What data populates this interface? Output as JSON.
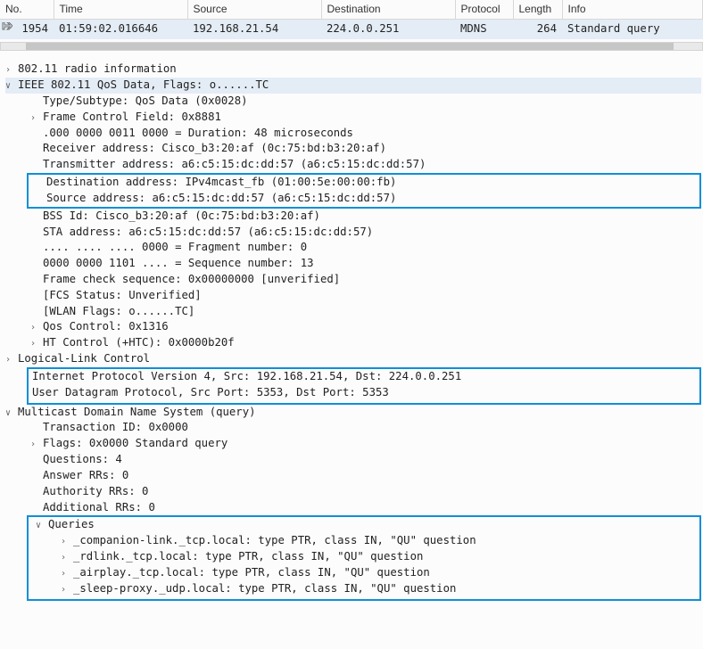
{
  "headers": {
    "no": "No.",
    "time": "Time",
    "src": "Source",
    "dst": "Destination",
    "proto": "Protocol",
    "len": "Length",
    "info": "Info"
  },
  "row": {
    "no": "1954",
    "time": "01:59:02.016646",
    "src": "192.168.21.54",
    "dst": "224.0.0.251",
    "proto": "MDNS",
    "len": "264",
    "info": "Standard query"
  },
  "tree": {
    "radio": "802.11 radio information",
    "ieee": "IEEE 802.11 QoS Data, Flags: o......TC",
    "ieee_children": {
      "type": "Type/Subtype: QoS Data (0x0028)",
      "fcf": "Frame Control Field: 0x8881",
      "duration": ".000 0000 0011 0000 = Duration: 48 microseconds",
      "recv": "Receiver address: Cisco_b3:20:af (0c:75:bd:b3:20:af)",
      "trans": "Transmitter address: a6:c5:15:dc:dd:57 (a6:c5:15:dc:dd:57)",
      "destaddr": "Destination address: IPv4mcast_fb (01:00:5e:00:00:fb)",
      "srcaddr": "Source address: a6:c5:15:dc:dd:57 (a6:c5:15:dc:dd:57)",
      "bss": "BSS Id: Cisco_b3:20:af (0c:75:bd:b3:20:af)",
      "sta": "STA address: a6:c5:15:dc:dd:57 (a6:c5:15:dc:dd:57)",
      "frag": ".... .... .... 0000 = Fragment number: 0",
      "seq": "0000 0000 1101 .... = Sequence number: 13",
      "fcs": "Frame check sequence: 0x00000000 [unverified]",
      "fcsstat": "[FCS Status: Unverified]",
      "wlanflags": "[WLAN Flags: o......TC]",
      "qos": "Qos Control: 0x1316",
      "ht": "HT Control (+HTC): 0x0000b20f"
    },
    "llc": "Logical-Link Control",
    "ipv4": "Internet Protocol Version 4, Src: 192.168.21.54, Dst: 224.0.0.251",
    "udp": "User Datagram Protocol, Src Port: 5353, Dst Port: 5353",
    "mdns": "Multicast Domain Name System (query)",
    "mdns_children": {
      "txid": "Transaction ID: 0x0000",
      "flags": "Flags: 0x0000 Standard query",
      "questions": "Questions: 4",
      "ans": "Answer RRs: 0",
      "auth": "Authority RRs: 0",
      "add": "Additional RRs: 0",
      "queries_label": "Queries",
      "queries": {
        "q1": "_companion-link._tcp.local: type PTR, class IN, \"QU\" question",
        "q2": "_rdlink._tcp.local: type PTR, class IN, \"QU\" question",
        "q3": "_airplay._tcp.local: type PTR, class IN, \"QU\" question",
        "q4": "_sleep-proxy._udp.local: type PTR, class IN, \"QU\" question"
      }
    }
  }
}
